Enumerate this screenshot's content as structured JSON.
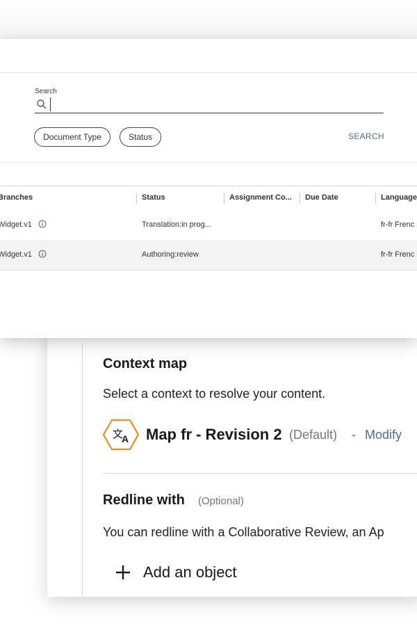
{
  "search": {
    "label": "Search",
    "value": "",
    "placeholder": "",
    "filters": [
      "Document Type",
      "Status"
    ],
    "button_label": "SEARCH"
  },
  "table": {
    "columns": [
      "Branches",
      "Status",
      "Assignment Co...",
      "Due Date",
      "Language"
    ],
    "rows": [
      {
        "branch": "Widget.v1",
        "status": "Translation:in prog...",
        "assignment": "",
        "due_date": "",
        "language": "fr-fr Frenc"
      },
      {
        "branch": "Widget.v1",
        "status": "Authoring:review",
        "assignment": "",
        "due_date": "",
        "language": "fr-fr Frenc"
      }
    ]
  },
  "context_map": {
    "title": "Context map",
    "description": "Select a context to resolve your content.",
    "map_name": "Map fr - Revision 2",
    "map_default": "(Default)",
    "separator": "-",
    "modify_label": "Modify"
  },
  "redline": {
    "title": "Redline with",
    "optional": "(Optional)",
    "description": "You can redline with a Collaborative Review, an Ap",
    "add_label": "Add an object"
  },
  "icons": {
    "search": "search-icon",
    "info": "info-icon",
    "translate": "translate-icon",
    "plus": "plus-icon"
  },
  "colors": {
    "accent": "#4a6f8c",
    "hex_icon": "#f08c1a"
  }
}
